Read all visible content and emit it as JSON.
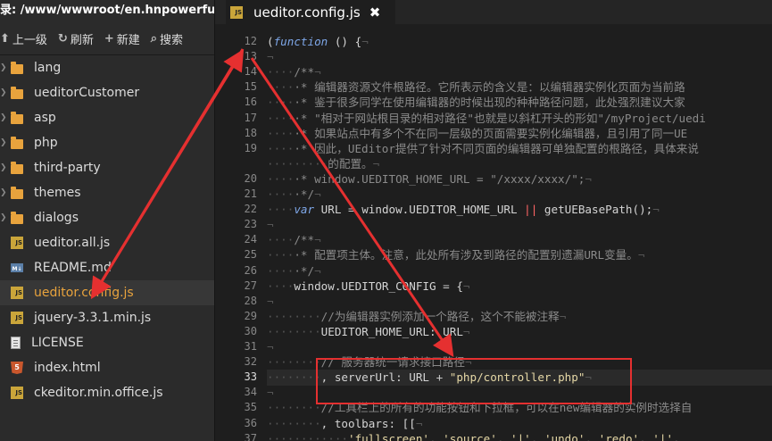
{
  "sidebar": {
    "path": "录: /www/wwwroot/en.hnpowerful.cc",
    "toolbar": [
      {
        "icon": "up-arrow-icon",
        "label": "上一级",
        "glyph": "⬆"
      },
      {
        "icon": "refresh-icon",
        "label": "刷新",
        "glyph": "↻"
      },
      {
        "icon": "plus-icon",
        "label": "新建",
        "glyph": "+"
      },
      {
        "icon": "search-icon",
        "label": "搜索",
        "glyph": "⌕"
      }
    ],
    "items": [
      {
        "label": "lang",
        "type": "folder"
      },
      {
        "label": "ueditorCustomer",
        "type": "folder"
      },
      {
        "label": "asp",
        "type": "folder"
      },
      {
        "label": "php",
        "type": "folder"
      },
      {
        "label": "third-party",
        "type": "folder"
      },
      {
        "label": "themes",
        "type": "folder"
      },
      {
        "label": "dialogs",
        "type": "folder"
      },
      {
        "label": "ueditor.all.js",
        "type": "js"
      },
      {
        "label": "README.md",
        "type": "md"
      },
      {
        "label": "ueditor.config.js",
        "type": "js",
        "selected": true
      },
      {
        "label": "jquery-3.3.1.min.js",
        "type": "js"
      },
      {
        "label": "LICENSE",
        "type": "file"
      },
      {
        "label": "index.html",
        "type": "html"
      },
      {
        "label": "ckeditor.min.office.js",
        "type": "js"
      }
    ]
  },
  "tab": {
    "title": "ueditor.config.js",
    "icon_label": "JS",
    "close": "✖"
  },
  "collapse_glyph": "❮",
  "md_badge": "M↓",
  "html_badge": "5",
  "editor": {
    "lines": [
      {
        "n": "12",
        "tokens": [
          [
            "pl",
            "("
          ],
          [
            "kw",
            "function"
          ],
          [
            "pl",
            " () {"
          ],
          [
            "dot",
            "¬"
          ]
        ]
      },
      {
        "n": "13",
        "tokens": [
          [
            "dot",
            "¬"
          ]
        ]
      },
      {
        "n": "14",
        "tokens": [
          [
            "dot",
            "····"
          ],
          [
            "cm",
            "/**"
          ],
          [
            "dot",
            "¬"
          ]
        ]
      },
      {
        "n": "15",
        "tokens": [
          [
            "dot",
            "····"
          ],
          [
            "cm",
            "·* 编辑器资源文件根路径。它所表示的含义是：以编辑器实例化页面为当前路"
          ]
        ]
      },
      {
        "n": "16",
        "tokens": [
          [
            "dot",
            "····"
          ],
          [
            "cm",
            "·* 鉴于很多同学在使用编辑器的时候出现的种种路径问题，此处强烈建议大家"
          ]
        ]
      },
      {
        "n": "17",
        "tokens": [
          [
            "dot",
            "····"
          ],
          [
            "cm",
            "·* \"相对于网站根目录的相对路径\"也就是以斜杠开头的形如\"/myProject/uedi"
          ]
        ]
      },
      {
        "n": "18",
        "tokens": [
          [
            "dot",
            "····"
          ],
          [
            "cm",
            "·* 如果站点中有多个不在同一层级的页面需要实例化编辑器，且引用了同一UE"
          ]
        ]
      },
      {
        "n": "19",
        "tokens": [
          [
            "dot",
            "····"
          ],
          [
            "cm",
            "·* 因此，UEditor提供了针对不同页面的编辑器可单独配置的根路径，具体来说"
          ]
        ]
      },
      {
        "n": "",
        "tokens": [
          [
            "dot",
            "·········"
          ],
          [
            "cm",
            "的配置。"
          ],
          [
            "dot",
            "¬"
          ]
        ]
      },
      {
        "n": "20",
        "tokens": [
          [
            "dot",
            "····"
          ],
          [
            "cm",
            "·* window.UEDITOR_HOME_URL = \"/xxxx/xxxx/\";"
          ],
          [
            "dot",
            "¬"
          ]
        ]
      },
      {
        "n": "21",
        "tokens": [
          [
            "dot",
            "····"
          ],
          [
            "cm",
            "·*/"
          ],
          [
            "dot",
            "¬"
          ]
        ]
      },
      {
        "n": "22",
        "tokens": [
          [
            "dot",
            "····"
          ],
          [
            "kw",
            "var"
          ],
          [
            "pl",
            " URL "
          ],
          [
            "op",
            "="
          ],
          [
            "pl",
            " window.UEDITOR_HOME_URL "
          ],
          [
            "pu",
            "||"
          ],
          [
            "pl",
            " getUEBasePath();"
          ],
          [
            "dot",
            "¬"
          ]
        ]
      },
      {
        "n": "23",
        "tokens": [
          [
            "dot",
            "¬"
          ]
        ]
      },
      {
        "n": "24",
        "tokens": [
          [
            "dot",
            "····"
          ],
          [
            "cm",
            "/**"
          ],
          [
            "dot",
            "¬"
          ]
        ]
      },
      {
        "n": "25",
        "tokens": [
          [
            "dot",
            "····"
          ],
          [
            "cm",
            "·* 配置项主体。注意，此处所有涉及到路径的配置别遗漏URL变量。"
          ],
          [
            "dot",
            "¬"
          ]
        ]
      },
      {
        "n": "26",
        "tokens": [
          [
            "dot",
            "····"
          ],
          [
            "cm",
            "·*/"
          ],
          [
            "dot",
            "¬"
          ]
        ]
      },
      {
        "n": "27",
        "tokens": [
          [
            "dot",
            "····"
          ],
          [
            "pl",
            "window.UEDITOR_CONFIG "
          ],
          [
            "op",
            "="
          ],
          [
            "pl",
            " {"
          ],
          [
            "dot",
            "¬"
          ]
        ]
      },
      {
        "n": "28",
        "tokens": [
          [
            "dot",
            "¬"
          ]
        ]
      },
      {
        "n": "29",
        "tokens": [
          [
            "dot",
            "········"
          ],
          [
            "cm",
            "//为编辑器实例添加一个路径，这个不能被注释"
          ],
          [
            "dot",
            "¬"
          ]
        ]
      },
      {
        "n": "30",
        "tokens": [
          [
            "dot",
            "········"
          ],
          [
            "pl",
            "UEDITOR_HOME_URL: URL"
          ],
          [
            "dot",
            "¬"
          ]
        ]
      },
      {
        "n": "31",
        "tokens": [
          [
            "dot",
            "¬"
          ]
        ]
      },
      {
        "n": "32",
        "tokens": [
          [
            "dot",
            "········"
          ],
          [
            "cm",
            "// 服务器统一请求接口路径"
          ],
          [
            "dot",
            "¬"
          ]
        ]
      },
      {
        "n": "33",
        "tokens": [
          [
            "dot",
            "········"
          ],
          [
            "pl",
            ", serverUrl: URL "
          ],
          [
            "op",
            "+"
          ],
          [
            "pl",
            " "
          ],
          [
            "st",
            "\"php/controller.php\""
          ],
          [
            "dot",
            "¬"
          ]
        ],
        "current": true
      },
      {
        "n": "34",
        "tokens": [
          [
            "dot",
            "¬"
          ]
        ]
      },
      {
        "n": "35",
        "tokens": [
          [
            "dot",
            "········"
          ],
          [
            "cm",
            "//工具栏上的所有的功能按钮和下拉框，可以在new编辑器的实例时选择自"
          ]
        ]
      },
      {
        "n": "36",
        "tokens": [
          [
            "dot",
            "········"
          ],
          [
            "pl",
            ", toolbars: [["
          ],
          [
            "dot",
            "¬"
          ]
        ]
      },
      {
        "n": "37",
        "tokens": [
          [
            "dot",
            "············"
          ],
          [
            "st",
            "'fullscreen'"
          ],
          [
            "pl",
            ", "
          ],
          [
            "st",
            "'source'"
          ],
          [
            "pl",
            ", "
          ],
          [
            "st",
            "'|'"
          ],
          [
            "pl",
            ", "
          ],
          [
            "st",
            "'undo'"
          ],
          [
            "pl",
            ", "
          ],
          [
            "st",
            "'redo'"
          ],
          [
            "pl",
            ", "
          ],
          [
            "st",
            "'|'"
          ],
          [
            "pl",
            ","
          ]
        ]
      }
    ]
  },
  "colors": {
    "accent": "#e8a33d",
    "annotation": "#e53030"
  }
}
